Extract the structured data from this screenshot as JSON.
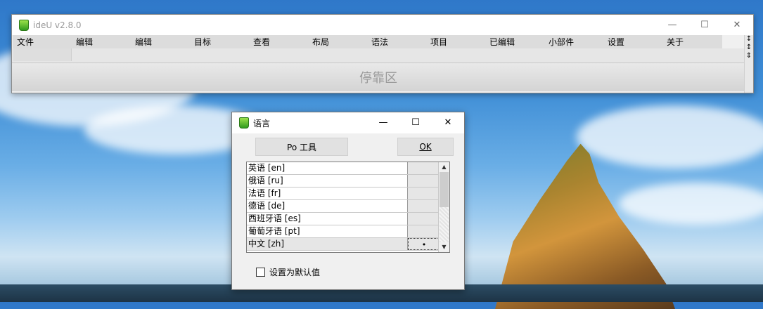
{
  "main_window": {
    "title": "ideU v2.8.0",
    "controls": {
      "minimize": "—",
      "maximize": "☐",
      "close": "✕"
    },
    "menu": [
      "文件",
      "编辑",
      "编辑",
      "目标",
      "查看",
      "布局",
      "语法",
      "项目",
      "已编辑",
      "小部件",
      "设置",
      "关于"
    ],
    "dock_label": "停靠区"
  },
  "language_dialog": {
    "title": "语言",
    "controls": {
      "minimize": "—",
      "maximize": "☐",
      "close": "✕"
    },
    "po_tool_button": "Po 工具",
    "ok_button": "OK",
    "languages": [
      {
        "name": "英语 [en]",
        "mark": ""
      },
      {
        "name": "俄语 [ru]",
        "mark": ""
      },
      {
        "name": "法语 [fr]",
        "mark": ""
      },
      {
        "name": "德语 [de]",
        "mark": ""
      },
      {
        "name": "西班牙语 [es]",
        "mark": ""
      },
      {
        "name": "葡萄牙语 [pt]",
        "mark": ""
      },
      {
        "name": "中文 [zh]",
        "mark": "•"
      }
    ],
    "default_checkbox_label": "设置为默认值",
    "scroll_up": "▲",
    "scroll_down": "▼"
  }
}
